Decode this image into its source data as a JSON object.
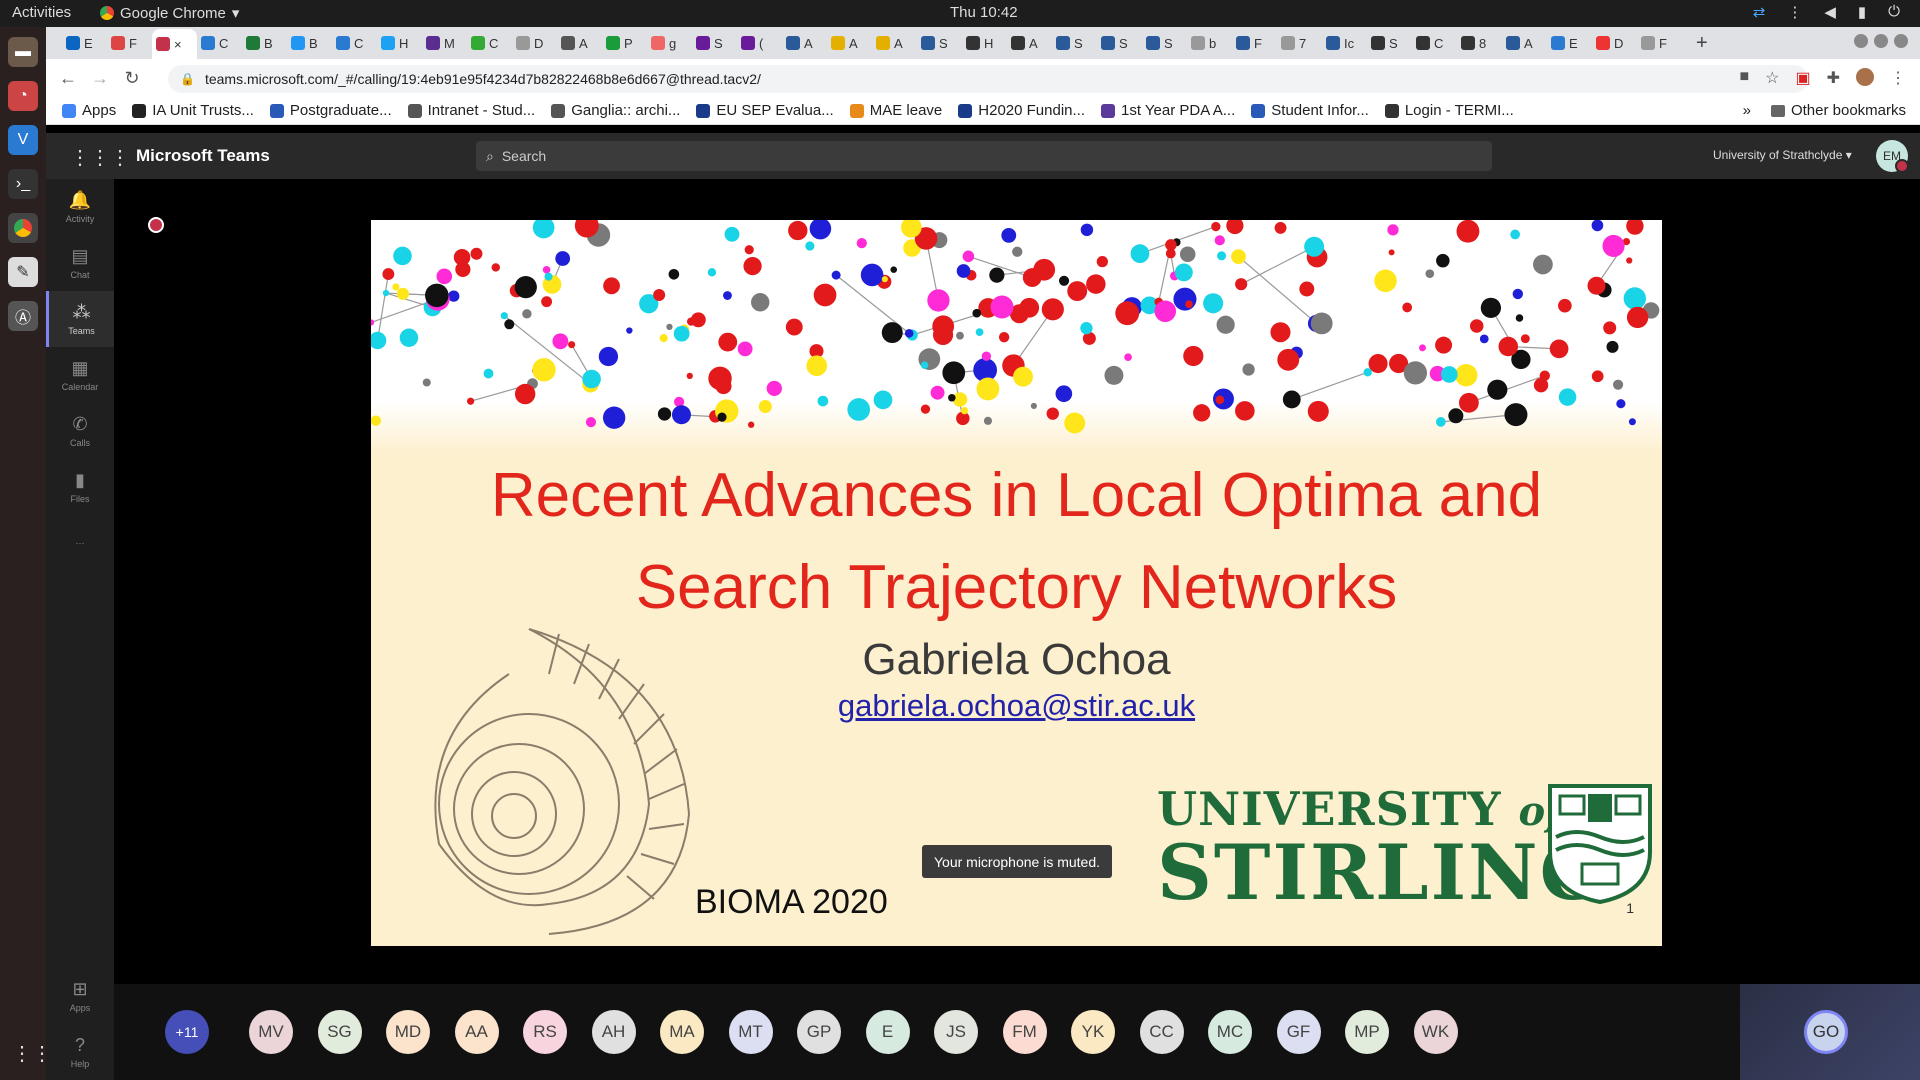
{
  "system_bar": {
    "activities": "Activities",
    "app_name": "Google Chrome",
    "clock": "Thu 10:42"
  },
  "browser": {
    "url": "teams.microsoft.com/_#/calling/19:4eb91e95f4234d7b82822468b8e6d667@thread.tacv2/",
    "tabs": [
      "E",
      "F",
      "×",
      "C",
      "B",
      "B",
      "C",
      "H",
      "M",
      "C",
      "D",
      "A",
      "P",
      "g",
      "S",
      "(",
      "A",
      "A",
      "A",
      "S",
      "H",
      "A",
      "S",
      "S",
      "S",
      "b",
      "F",
      "7",
      "Ic",
      "S",
      "C",
      "8",
      "A",
      "E",
      "D",
      "F"
    ],
    "bookmarks": [
      "Apps",
      "IA Unit Trusts...",
      "Postgraduate...",
      "Intranet - Stud...",
      "Ganglia:: archi...",
      "EU SEP Evalua...",
      "MAE leave",
      "H2020 Fundin...",
      "1st Year PDA A...",
      "Student Infor...",
      "Login - TERMI..."
    ],
    "other_bookmarks": "Other bookmarks"
  },
  "teams": {
    "title": "Microsoft Teams",
    "search_placeholder": "Search",
    "org": "University of Strathclyde",
    "me_initials": "EM",
    "rail": [
      {
        "label": "Activity",
        "icon": "bell-icon"
      },
      {
        "label": "Chat",
        "icon": "chat-icon"
      },
      {
        "label": "Teams",
        "icon": "teams-icon"
      },
      {
        "label": "Calendar",
        "icon": "calendar-icon"
      },
      {
        "label": "Calls",
        "icon": "phone-icon"
      },
      {
        "label": "Files",
        "icon": "file-icon"
      }
    ],
    "rail_bottom": [
      {
        "label": "Apps",
        "icon": "apps-icon"
      },
      {
        "label": "Help",
        "icon": "help-icon"
      }
    ]
  },
  "slide": {
    "title_line1": "Recent Advances in Local Optima and",
    "title_line2": "Search Trajectory Networks",
    "author": "Gabriela Ochoa",
    "email": "gabriela.ochoa@stir.ac.uk",
    "conference": "BIOMA 2020",
    "university_line1": "UNIVERSITY",
    "university_of": "of",
    "university_line2": "STIRLING",
    "page_number": "1"
  },
  "toast": "Your microphone is muted.",
  "participants": {
    "overflow": "+11",
    "list": [
      {
        "initials": "MV",
        "color": "#ecd5d8"
      },
      {
        "initials": "SG",
        "color": "#e2ecdc"
      },
      {
        "initials": "MD",
        "color": "#fbe3cc"
      },
      {
        "initials": "AA",
        "color": "#fbe3cc"
      },
      {
        "initials": "RS",
        "color": "#f8d4df"
      },
      {
        "initials": "AH",
        "color": "#e0e0e0"
      },
      {
        "initials": "MA",
        "color": "#fbe9c4"
      },
      {
        "initials": "MT",
        "color": "#dcdff2"
      },
      {
        "initials": "GP",
        "color": "#e0e0e0"
      },
      {
        "initials": "E",
        "color": "#d6eadf"
      },
      {
        "initials": "JS",
        "color": "#e2e6de"
      },
      {
        "initials": "FM",
        "color": "#fcdcd2"
      },
      {
        "initials": "YK",
        "color": "#fbe9c4"
      },
      {
        "initials": "CC",
        "color": "#e0e0e0"
      },
      {
        "initials": "MC",
        "color": "#d6eadf"
      },
      {
        "initials": "GF",
        "color": "#dcdff2"
      },
      {
        "initials": "MP",
        "color": "#e2ecdc"
      },
      {
        "initials": "WK",
        "color": "#ecd5d8"
      }
    ],
    "self_initials": "GO"
  }
}
